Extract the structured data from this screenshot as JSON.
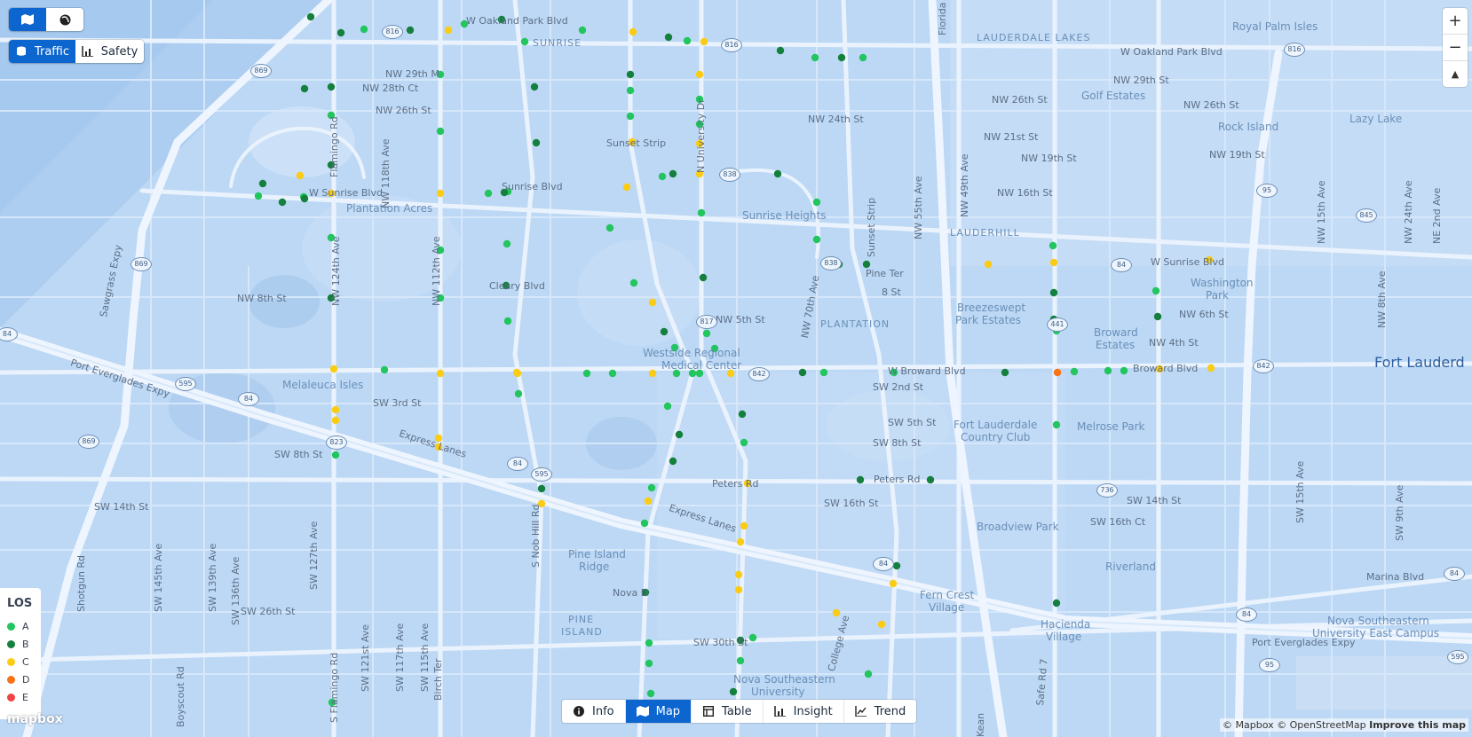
{
  "top_toggle": {
    "map_icon": "map-icon",
    "globe_icon": "globe-icon"
  },
  "layer_tabs": [
    {
      "label": "Traffic",
      "icon": "database-icon",
      "active": true
    },
    {
      "label": "Safety",
      "icon": "chart-icon",
      "active": false
    }
  ],
  "zoom_controls": {
    "zoom_in": "+",
    "zoom_out": "−",
    "compass": "▲"
  },
  "legend": {
    "title": "LOS",
    "items": [
      {
        "label": "A",
        "color": "#22c55e"
      },
      {
        "label": "B",
        "color": "#15803d"
      },
      {
        "label": "C",
        "color": "#facc15"
      },
      {
        "label": "D",
        "color": "#f97316"
      },
      {
        "label": "E",
        "color": "#ef4444"
      }
    ]
  },
  "bottom_tabs": [
    {
      "label": "Info",
      "icon": "info-icon",
      "active": false
    },
    {
      "label": "Map",
      "icon": "map-icon",
      "active": true
    },
    {
      "label": "Table",
      "icon": "table-icon",
      "active": false
    },
    {
      "label": "Insight",
      "icon": "chart-icon",
      "active": false
    },
    {
      "label": "Trend",
      "icon": "trend-icon",
      "active": false
    }
  ],
  "attribution": {
    "mapbox": "© Mapbox",
    "osm": "© OpenStreetMap",
    "improve": "Improve this map"
  },
  "logo": "mapbox",
  "map_labels": {
    "oakland_park_1": "W Oakland Park Blvd",
    "oakland_park_2": "W Oakland Park Blvd",
    "sunrise_area": "SUNRISE",
    "lauderdale_lakes": "LAUDERDALE LAKES",
    "royal_palm": "Royal Palm Isles",
    "golf_estates": "Golf Estates",
    "rock_island": "Rock Island",
    "lazy_lake": "Lazy Lake",
    "nw29m": "NW 29th M",
    "nw28ct": "NW 28th Ct",
    "nw26st_w": "NW 26th St",
    "nw26st_e": "NW 26th St",
    "nw26st_ee": "NW 26th St",
    "nw29st": "NW 29th St",
    "nw24st": "NW 24th St",
    "nw21st": "NW 21st St",
    "nw19st": "NW 19th St",
    "nw19st_e": "NW 19th St",
    "nw16st": "NW 16th St",
    "sunset_strip": "Sunset Strip",
    "sunrise_blvd": "W Sunrise Blvd",
    "sunrise_blvd2": "Sunrise Blvd",
    "w_sunrise_e": "W Sunrise Blvd",
    "plantation_acres": "Plantation Acres",
    "sunrise_heights": "Sunrise Heights",
    "cleary": "Cleary Blvd",
    "nw8st": "NW 8th St",
    "nw5st": "NW 5th St",
    "plantation": "PLANTATION",
    "pine_ter": "Pine Ter",
    "st8": "8 St",
    "lauderhill": "LAUDERHILL",
    "breezeswept": "Breezeswept",
    "park_estates": "Park Estates",
    "broward_estates": "Broward",
    "broward_estates2": "Estates",
    "washington_park": "Washington",
    "washington_park2": "Park",
    "nw6st": "NW 6th St",
    "nw4st": "NW 4th St",
    "westside1": "Westside Regional",
    "westside2": "Medical Center",
    "w_broward": "W Broward Blvd",
    "broward_blvd": "Broward Blvd",
    "fort_lauderdale": "Fort Lauderd",
    "melaleuca": "Melaleuca Isles",
    "port_everglades": "Port Everglades Expy",
    "port_everglades2": "Port Everglades Expy",
    "sw3st": "SW 3rd St",
    "sw2st": "SW 2nd St",
    "sw5st": "SW 5th St",
    "sw8st_e": "SW 8th St",
    "ftl_country1": "Fort Lauderdale",
    "ftl_country2": "Country Club",
    "melrose": "Melrose Park",
    "express_lanes": "Express Lanes",
    "express_lanes2": "Express Lanes",
    "sw8st_w": "SW 8th St",
    "sw14st": "SW 14th St",
    "sw14st_e": "SW 14th St",
    "peters_rd": "Peters Rd",
    "peters_rd2": "Peters Rd",
    "sw16st": "SW 16th St",
    "sw16ct": "SW 16th Ct",
    "broadview": "Broadview Park",
    "riverland": "Riverland",
    "pine_island_ridge": "Pine Island",
    "pine_island_ridge2": "Ridge",
    "pine_island": "PINE",
    "pine_island2": "ISLAND",
    "nova": "Nova D",
    "fern_crest": "Fern Crest",
    "fern_crest2": "Village",
    "hacienda": "Hacienda",
    "hacienda2": "Village",
    "marina": "Marina Blvd",
    "nova_se": "Nova Southeastern",
    "nova_se2": "University East Campus",
    "nova_univ": "Nova Southeastern",
    "nova_univ2": "University",
    "sw26st": "SW 26th St",
    "sw30st": "SW 30th St",
    "sawgrass": "Sawgrass Expy",
    "flamingo": "S Flamingo Rd",
    "flamingo_n": "Flamingo Rd",
    "nob_hill": "S Nob Hill Rd",
    "university": "N University Dr",
    "nw124": "NW 124th Ave",
    "nw118": "NW 118th Ave",
    "nw112": "NW 112th Ave",
    "nw70": "NW 70th Ave",
    "nw55": "NW 55th Ave",
    "nw49": "NW 49th Ave",
    "sunset_strip_v": "Sunset Strip",
    "college": "College Ave",
    "safe_rd": "Safe Rd 7",
    "sw145": "SW 145th Ave",
    "sw139": "SW 139th Ave",
    "sw136": "SW 136th Ave",
    "sw127": "SW 127th Ave",
    "sw121": "SW 121st Ave",
    "sw117": "SW 117th Ave",
    "sw115": "SW 115th Ave",
    "birch": "Birch Ter",
    "shotgun": "Shotgun Rd",
    "boyscout": "Boyscout Rd",
    "nw15": "NW 15th Ave",
    "nw8": "NW 8th Ave",
    "nw24": "NW 24th Ave",
    "ne2": "NE 2nd Ave",
    "sw15": "SW 15th Ave",
    "sw9": "SW 9th Ave",
    "florida": "Florida",
    "kean": "Kean"
  },
  "shields": [
    "816",
    "816",
    "816",
    "869",
    "869",
    "869",
    "84",
    "84",
    "84",
    "84",
    "84",
    "84",
    "823",
    "595",
    "595",
    "595",
    "95",
    "95",
    "838",
    "838",
    "817",
    "842",
    "842",
    "441",
    "736",
    "845",
    "84"
  ]
}
